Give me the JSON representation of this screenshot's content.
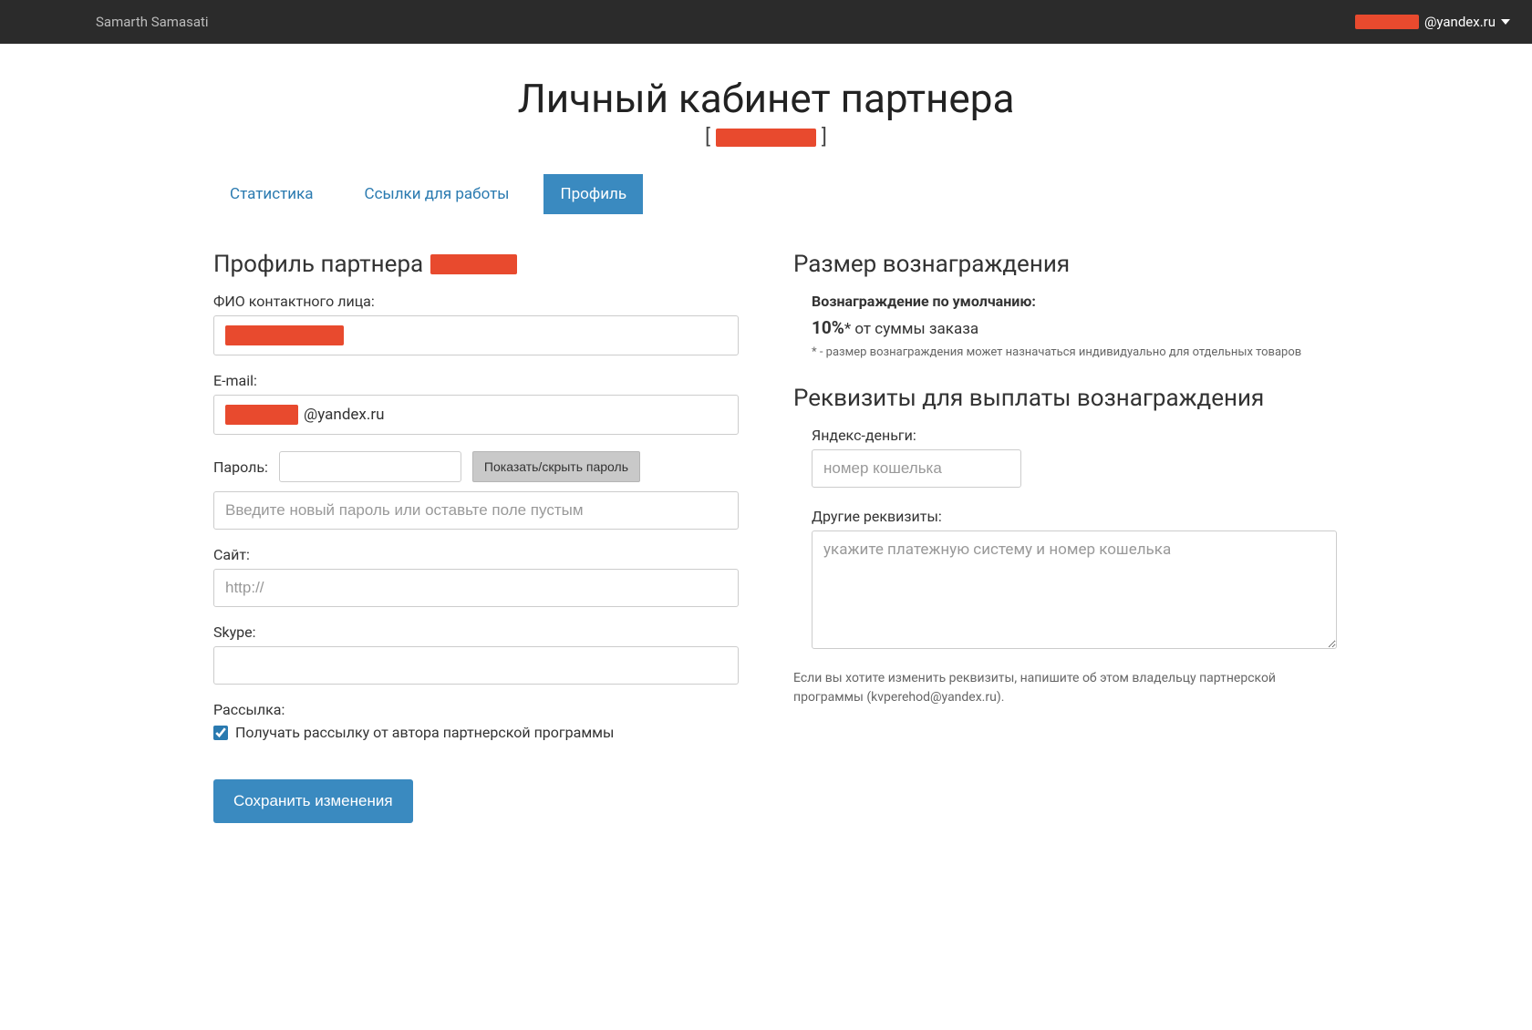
{
  "header": {
    "brand": "Samarth Samasati",
    "user_suffix": "@yandex.ru"
  },
  "page": {
    "title": "Личный кабинет партнера",
    "subtitle_prefix": "[",
    "subtitle_suffix": "]"
  },
  "tabs": {
    "stats": "Статистика",
    "links": "Ссылки для работы",
    "profile": "Профиль"
  },
  "profile": {
    "heading_prefix": "Профиль партнера",
    "fio_label": "ФИО контактного лица:",
    "email_label": "E-mail:",
    "email_suffix": "@yandex.ru",
    "password_label": "Пароль:",
    "password_toggle": "Показать/скрыть пароль",
    "password_placeholder": "Введите новый пароль или оставьте поле пустым",
    "site_label": "Сайт:",
    "site_placeholder": "http://",
    "skype_label": "Skype:",
    "newsletter_label": "Рассылка:",
    "newsletter_checkbox": "Получать рассылку от автора партнерской программы",
    "save_button": "Сохранить изменения"
  },
  "reward": {
    "heading": "Размер вознаграждения",
    "default_label": "Вознаграждение по умолчанию:",
    "percent": "10%",
    "percent_note": "* от суммы заказа",
    "disclaimer": "* - размер вознаграждения может назначаться индивидуально для отдельных товаров"
  },
  "payout": {
    "heading": "Реквизиты для выплаты вознаграждения",
    "yandex_label": "Яндекс-деньги:",
    "yandex_placeholder": "номер кошелька",
    "other_label": "Другие реквизиты:",
    "other_placeholder": "укажите платежную систему и номер кошелька",
    "footnote": "Если вы хотите изменить реквизиты, напишите об этом владельцу партнерской программы (kvperehod@yandex.ru)."
  }
}
